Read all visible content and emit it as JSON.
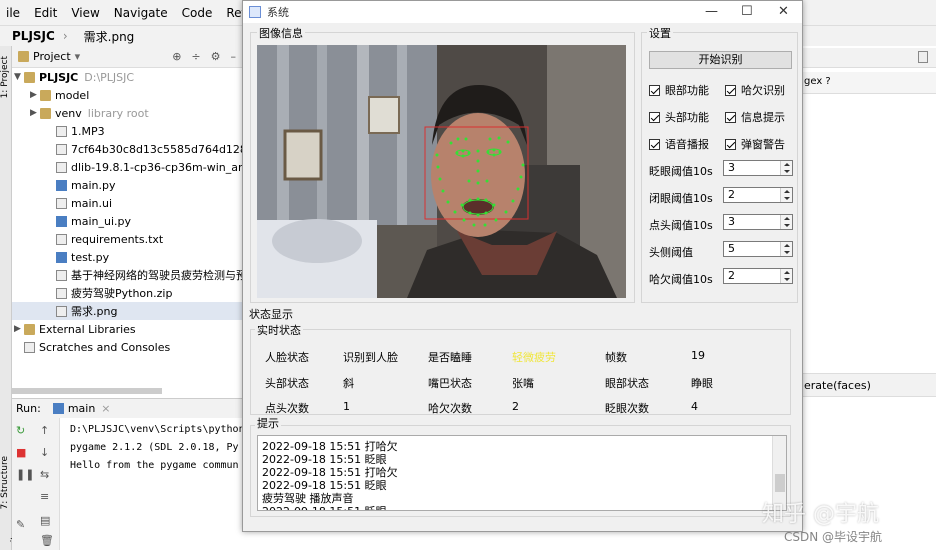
{
  "ide": {
    "menu": [
      "ile",
      "Edit",
      "View",
      "Navigate",
      "Code",
      "Refactor",
      "Ru"
    ],
    "crumb_project": "PLJSJC",
    "crumb_file": "需求.png",
    "project_label": "Project",
    "tree": [
      {
        "label": "PLJSJC",
        "extra": "D:\\PLJSJC",
        "type": "folder",
        "depth": 0,
        "arrow": "▼"
      },
      {
        "label": "model",
        "extra": "",
        "type": "folder",
        "depth": 1,
        "arrow": "▶"
      },
      {
        "label": "venv",
        "extra": "library root",
        "type": "folder",
        "depth": 1,
        "arrow": "▶"
      },
      {
        "label": "1.MP3",
        "extra": "",
        "type": "file",
        "depth": 2,
        "arrow": ""
      },
      {
        "label": "7cf64b30c8d13c5585d764d12819c53",
        "extra": "",
        "type": "file",
        "depth": 2,
        "arrow": ""
      },
      {
        "label": "dlib-19.8.1-cp36-cp36m-win_amd64.",
        "extra": "",
        "type": "file",
        "depth": 2,
        "arrow": ""
      },
      {
        "label": "main.py",
        "extra": "",
        "type": "py",
        "depth": 2,
        "arrow": ""
      },
      {
        "label": "main.ui",
        "extra": "",
        "type": "file",
        "depth": 2,
        "arrow": ""
      },
      {
        "label": "main_ui.py",
        "extra": "",
        "type": "py",
        "depth": 2,
        "arrow": ""
      },
      {
        "label": "requirements.txt",
        "extra": "",
        "type": "file",
        "depth": 2,
        "arrow": ""
      },
      {
        "label": "test.py",
        "extra": "",
        "type": "py",
        "depth": 2,
        "arrow": ""
      },
      {
        "label": "基于神经网络的驾驶员疲劳检测与预警系",
        "extra": "",
        "type": "file",
        "depth": 2,
        "arrow": ""
      },
      {
        "label": "疲劳驾驶Python.zip",
        "extra": "",
        "type": "file",
        "depth": 2,
        "arrow": ""
      },
      {
        "label": "需求.png",
        "extra": "",
        "type": "file",
        "depth": 2,
        "arrow": ""
      },
      {
        "label": "External Libraries",
        "extra": "",
        "type": "folder",
        "depth": 0,
        "arrow": "▶"
      },
      {
        "label": "Scratches and Consoles",
        "extra": "",
        "type": "file",
        "depth": 0,
        "arrow": ""
      }
    ],
    "run_label": "Run:",
    "run_tab": "main",
    "console": [
      "D:\\PLJSJC\\venv\\Scripts\\python",
      "pygame 2.1.2 (SDL 2.0.18, Py",
      "Hello from the pygame commun"
    ],
    "right_hint": "gex ?",
    "right_code": "erate(faces)",
    "side_tabs": [
      "1: Project",
      "7: Structure",
      "2: Favorites"
    ]
  },
  "window": {
    "title": "系统",
    "minimize": "—",
    "maximize": "☐",
    "close": "✕"
  },
  "image_group": {
    "title": "图像信息"
  },
  "settings": {
    "title": "设置",
    "start_button": "开始识别",
    "checks": [
      {
        "label": "眼部功能",
        "checked": true
      },
      {
        "label": "哈欠识别",
        "checked": true
      },
      {
        "label": "头部功能",
        "checked": true
      },
      {
        "label": "信息提示",
        "checked": true
      },
      {
        "label": "语音播报",
        "checked": true
      },
      {
        "label": "弹窗警告",
        "checked": true
      }
    ],
    "params": [
      {
        "label": "眨眼阈值10s",
        "value": "3"
      },
      {
        "label": "闭眼阈值10s",
        "value": "2"
      },
      {
        "label": "点头阈值10s",
        "value": "3"
      },
      {
        "label": "头侧阈值",
        "value": "5"
      },
      {
        "label": "哈欠阈值10s",
        "value": "2"
      }
    ]
  },
  "status": {
    "title": "状态显示",
    "realtime_title": "实时状态",
    "rows": [
      [
        {
          "label": "人脸状态",
          "value": "识别到人脸"
        },
        {
          "label": "是否瞌睡",
          "value": "轻微疲劳",
          "highlight": "#f0e63c"
        },
        {
          "label": "帧数",
          "value": "19"
        }
      ],
      [
        {
          "label": "头部状态",
          "value": "斜"
        },
        {
          "label": "嘴巴状态",
          "value": "张嘴"
        },
        {
          "label": "眼部状态",
          "value": "睁眼"
        }
      ],
      [
        {
          "label": "点头次数",
          "value": "1"
        },
        {
          "label": "哈欠次数",
          "value": "2"
        },
        {
          "label": "眨眼次数",
          "value": "4"
        }
      ]
    ]
  },
  "tips": {
    "title": "提示",
    "lines": [
      "2022-09-18 15:51 打哈欠",
      "2022-09-18 15:51 眨眼",
      "2022-09-18 15:51 打哈欠",
      "2022-09-18 15:51 眨眼",
      "疲劳驾驶 播放声音",
      "2022-09-18 15:51 眨眼"
    ]
  },
  "watermark": {
    "main": "知乎 @宇航",
    "sub": "CSDN @毕设宇航"
  }
}
